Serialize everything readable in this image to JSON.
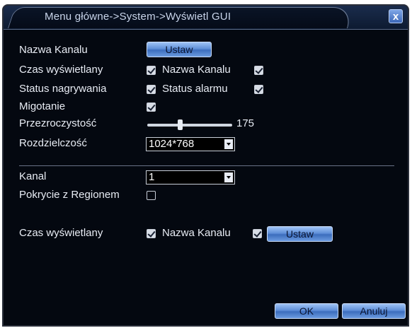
{
  "title": "Menu główne->System->Wyświetl GUI",
  "close_label": "x",
  "rows": {
    "channel_name": {
      "label": "Nazwa Kanalu",
      "button": "Ustaw"
    },
    "display_time": {
      "label": "Czas wyświetlany",
      "checked": true,
      "secondary_label": "Nazwa Kanalu",
      "secondary_checked": true
    },
    "record_status": {
      "label": "Status nagrywania",
      "checked": true,
      "secondary_label": "Status alarmu",
      "secondary_checked": true
    },
    "blinking": {
      "label": "Migotanie",
      "checked": true
    },
    "transparency": {
      "label": "Przezroczystość",
      "value": "175",
      "min": 128,
      "max": 255
    },
    "resolution": {
      "label": "Rozdzielczość",
      "value": "1024*768"
    }
  },
  "region": {
    "channel_label": "Kanal",
    "channel_value": "1",
    "coverage_label": "Pokrycie z Regionem",
    "coverage_checked": false,
    "display_time_label": "Czas wyświetlany",
    "display_time_checked": true,
    "channel_name_label": "Nazwa Kanalu",
    "channel_name_checked": true,
    "set_button": "Ustaw"
  },
  "footer": {
    "ok": "OK",
    "cancel": "Anuluj"
  },
  "colors": {
    "background": "#040810",
    "text": "#e8ecf4",
    "button_blue": "#5f8fd8",
    "title_text": "#c8d4ea"
  }
}
